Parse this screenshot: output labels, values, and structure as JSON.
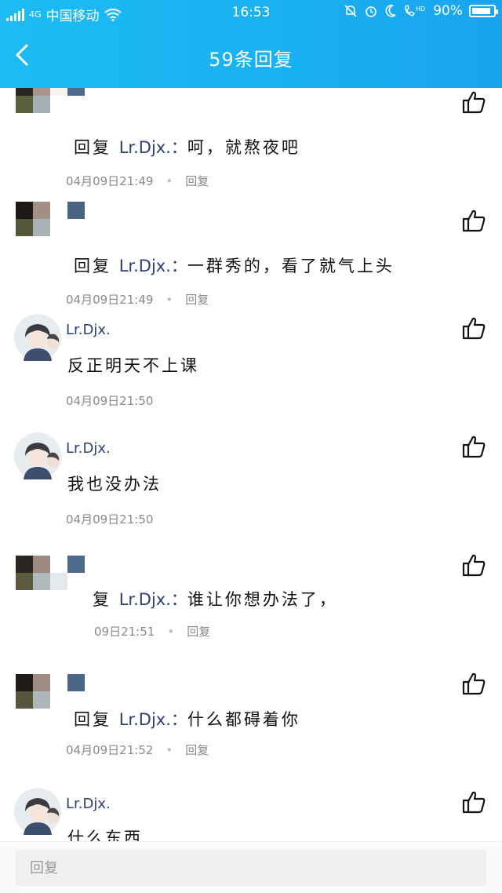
{
  "status_bar": {
    "carrier": "中国移动",
    "network_label": "4G",
    "time": "16:53",
    "battery": "90%",
    "battery_fraction": 0.9
  },
  "header": {
    "back_icon": "chevron-left-icon",
    "title": "59条回复"
  },
  "comments": [
    {
      "author": "",
      "reply_prefix": "回复",
      "reply_to": "Lr.Djx.：",
      "text": "呵，就熬夜吧",
      "date": "04月09日21:49",
      "reply_label": "回复",
      "avatar": "mosaic"
    },
    {
      "author": "",
      "reply_prefix": "回复",
      "reply_to": "Lr.Djx.：",
      "text": "一群秀的，看了就气上头",
      "date": "04月09日21:49",
      "reply_label": "回复",
      "avatar": "mosaic"
    },
    {
      "author": "Lr.Djx.",
      "reply_prefix": "",
      "reply_to": "",
      "text": "反正明天不上课",
      "date": "04月09日21:50",
      "reply_label": "",
      "avatar": "anime"
    },
    {
      "author": "Lr.Djx.",
      "reply_prefix": "",
      "reply_to": "",
      "text": "我也没办法",
      "date": "04月09日21:50",
      "reply_label": "",
      "avatar": "anime"
    },
    {
      "author": "",
      "reply_prefix": "复",
      "reply_to": "Lr.Djx.：",
      "text": "谁让你想办法了，",
      "date": "09日21:51",
      "reply_label": "回复",
      "avatar": "mosaic"
    },
    {
      "author": "",
      "reply_prefix": "回复",
      "reply_to": "Lr.Djx.：",
      "text": "什么都碍着你",
      "date": "04月09日21:52",
      "reply_label": "回复",
      "avatar": "mosaic"
    },
    {
      "author": "Lr.Djx.",
      "reply_prefix": "",
      "reply_to": "",
      "text": "什么东西",
      "date": "",
      "reply_label": "",
      "avatar": "anime"
    }
  ],
  "reply_bar": {
    "placeholder": "回复"
  },
  "colors": {
    "header_bg": "#19b1f1",
    "link": "#2b3f73"
  }
}
